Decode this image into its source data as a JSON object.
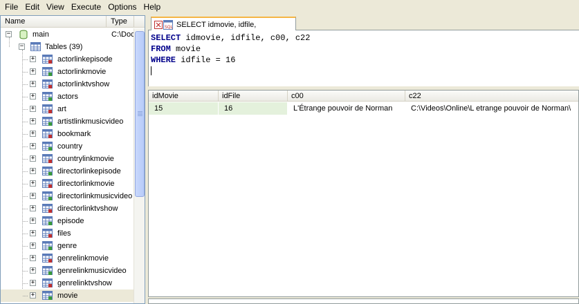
{
  "menu": [
    "File",
    "Edit",
    "View",
    "Execute",
    "Options",
    "Help"
  ],
  "tree": {
    "columns": {
      "name": "Name",
      "type": "Type"
    },
    "root": {
      "label": "main",
      "type": "C:\\Doc"
    },
    "tables_node": {
      "label": "Tables (39)"
    },
    "tables": [
      "actorlinkepisode",
      "actorlinkmovie",
      "actorlinktvshow",
      "actors",
      "art",
      "artistlinkmusicvideo",
      "bookmark",
      "country",
      "countrylinkmovie",
      "directorlinkepisode",
      "directorlinkmovie",
      "directorlinkmusicvideo",
      "directorlinktvshow",
      "episode",
      "files",
      "genre",
      "genrelinkmovie",
      "genrelinkmusicvideo",
      "genrelinktvshow",
      "movie"
    ],
    "selected": "movie"
  },
  "tab": {
    "label": "SELECT idmovie, idfile,"
  },
  "query": {
    "line1": {
      "kw": "SELECT",
      "rest": " idmovie, idfile, c00, c22"
    },
    "line2": {
      "kw": "FROM",
      "rest": " movie"
    },
    "line3": {
      "kw": "WHERE",
      "rest": " idfile = 16"
    }
  },
  "results": {
    "columns": [
      "idMovie",
      "idFile",
      "c00",
      "c22"
    ],
    "rows": [
      [
        "15",
        "16",
        "L'Étrange pouvoir de Norman",
        "C:\\Videos\\Online\\L etrange pouvoir de Norman\\"
      ]
    ]
  },
  "colors": {
    "keyword": "#00008b",
    "row_highlight": "#e4f1dc",
    "tab_accent": "#f5b544"
  }
}
